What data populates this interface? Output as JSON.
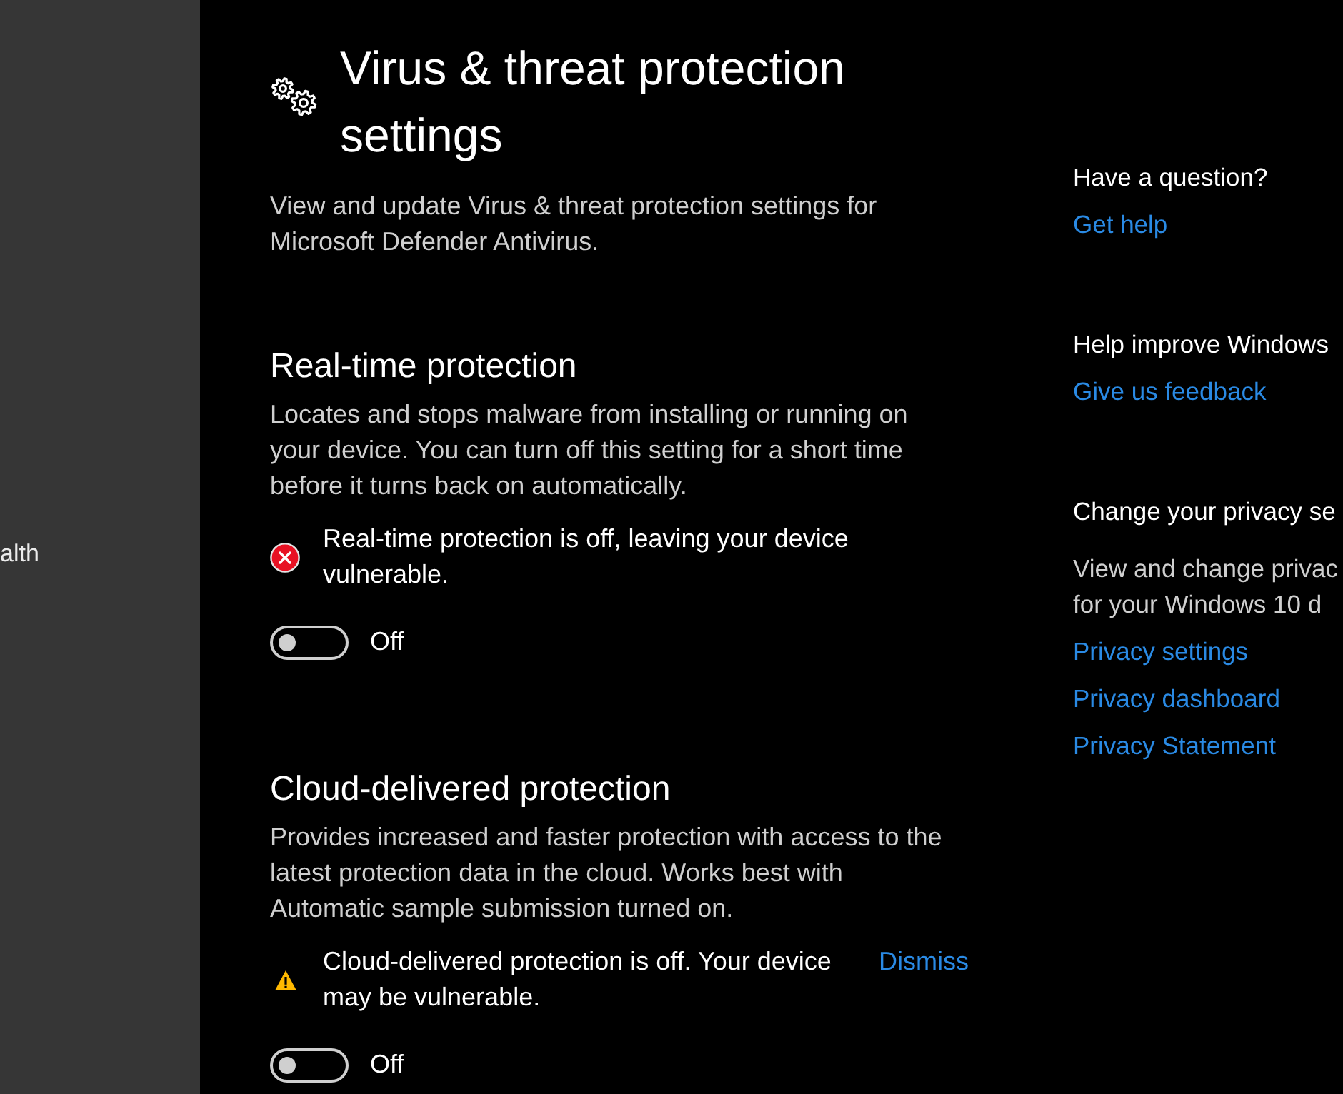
{
  "sidebar": {
    "items": [
      {
        "label": "alth"
      }
    ]
  },
  "header": {
    "title": "Virus & threat protection settings",
    "description": "View and update Virus & threat protection settings for Microsoft Defender Antivirus."
  },
  "sections": [
    {
      "heading": "Real-time protection",
      "description": "Locates and stops malware from installing or running on your device. You can turn off this setting for a short time before it turns back on automatically.",
      "alert": {
        "kind": "error",
        "text": "Real-time protection is off, leaving your device vulnerable."
      },
      "toggle": {
        "on": false,
        "label": "Off"
      }
    },
    {
      "heading": "Cloud-delivered protection",
      "description": "Provides increased and faster protection with access to the latest protection data in the cloud. Works best with Automatic sample submission turned on.",
      "alert": {
        "kind": "warning",
        "text": "Cloud-delivered protection is off. Your device may be vulnerable.",
        "action": "Dismiss"
      },
      "toggle": {
        "on": false,
        "label": "Off"
      }
    }
  ],
  "aside": [
    {
      "heading": "Have a question?",
      "links": [
        "Get help"
      ]
    },
    {
      "heading": "Help improve Windows",
      "links": [
        "Give us feedback"
      ]
    },
    {
      "heading": "Change your privacy se",
      "description_lines": [
        "View and change privac",
        "for your Windows 10 d"
      ],
      "links": [
        "Privacy settings",
        "Privacy dashboard",
        "Privacy Statement"
      ]
    }
  ]
}
